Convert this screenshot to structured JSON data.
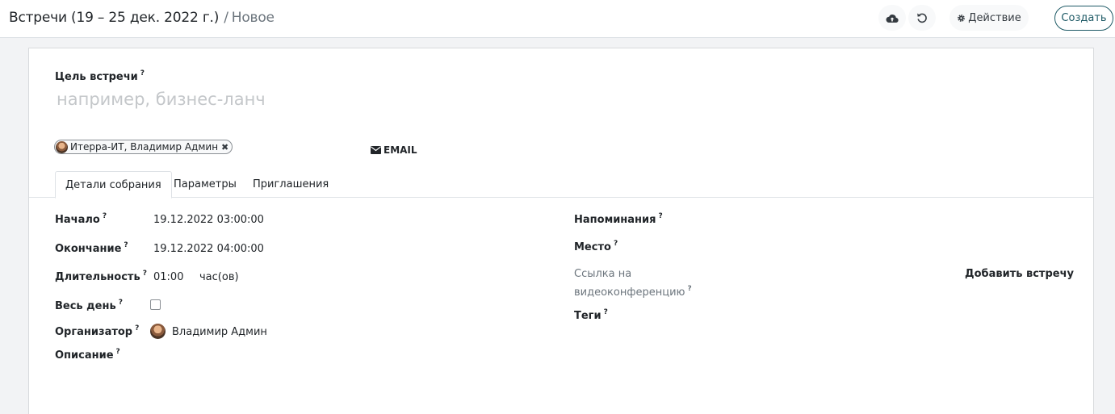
{
  "breadcrumb": {
    "parent": "Встречи (19 – 25 дек. 2022 г.)",
    "separator": "/",
    "current": "Новое"
  },
  "toolbar": {
    "save_icon": "cloud-upload-icon",
    "discard_icon": "undo-icon",
    "action_label": "Действие",
    "action_icon": "gear-icon",
    "create_label": "Создать"
  },
  "form": {
    "title_label": "Цель встречи",
    "title_placeholder": "например, бизнес-ланч",
    "title_value": "",
    "help_mark": "?",
    "attendee_tag": "Итерра-ИТ, Владимир Админ",
    "email_label": "EMAIL",
    "tabs": [
      {
        "label": "Детали собрания",
        "active": true
      },
      {
        "label": "Параметры",
        "active": false
      },
      {
        "label": "Приглашения",
        "active": false
      }
    ],
    "left_fields": {
      "start_label": "Начало",
      "start_value": "19.12.2022 03:00:00",
      "stop_label": "Окончание",
      "stop_value": "19.12.2022 04:00:00",
      "duration_label": "Длительность",
      "duration_value": "01:00",
      "duration_unit": "час(ов)",
      "allday_label": "Весь день",
      "allday_checked": false,
      "organizer_label": "Организатор",
      "organizer_value": "Владимир Админ",
      "description_label": "Описание"
    },
    "right_fields": {
      "reminders_label": "Напоминания",
      "location_label": "Место",
      "video_label_line1": "Ссылка на",
      "video_label_line2": "видеоконференцию",
      "add_meeting_label": "Добавить встречу",
      "tags_label": "Теги"
    }
  },
  "colors": {
    "accent": "#1e5a66",
    "muted": "#6c757d",
    "placeholder": "#c4c7ca"
  }
}
